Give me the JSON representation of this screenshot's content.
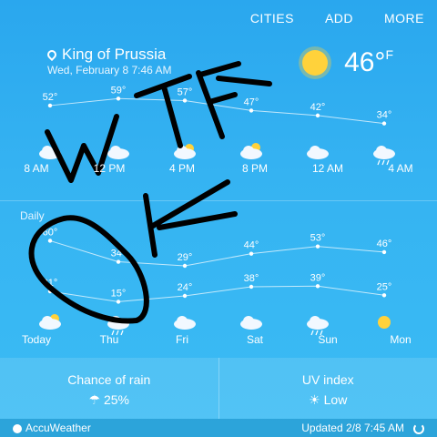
{
  "nav": [
    "CITIES",
    "ADD",
    "MORE"
  ],
  "location": "King of Prussia",
  "datetime": "Wed, February 8 7:46 AM",
  "current": {
    "temp": "46°",
    "unit": "F"
  },
  "hourly": {
    "times": [
      "8 AM",
      "12 PM",
      "4 PM",
      "8 PM",
      "12 AM",
      "4 AM"
    ],
    "temps": [
      52,
      59,
      57,
      47,
      42,
      34
    ],
    "icons": [
      "cloud-icon",
      "cloud-icon",
      "partly-sunny-icon",
      "moon-cloud-icon",
      "cloud-icon",
      "rain-icon"
    ]
  },
  "daily": {
    "label": "Daily",
    "days": [
      "Today",
      "Thu",
      "Fri",
      "Sat",
      "Sun",
      "Mon"
    ],
    "highs": [
      60,
      34,
      29,
      44,
      53,
      46
    ],
    "lows": [
      31,
      15,
      24,
      38,
      39,
      25
    ],
    "icons": [
      "partly-sunny-icon",
      "snow-icon",
      "cloud-icon",
      "cloud-icon",
      "rain-icon",
      "sun-icon"
    ]
  },
  "chance_of_rain": {
    "title": "Chance of rain",
    "value": "25%"
  },
  "uv": {
    "title": "UV index",
    "value": "Low"
  },
  "footer": {
    "brand": "AccuWeather",
    "updated": "Updated 2/8  7:45 AM"
  },
  "annotation_text": "WTF OK"
}
